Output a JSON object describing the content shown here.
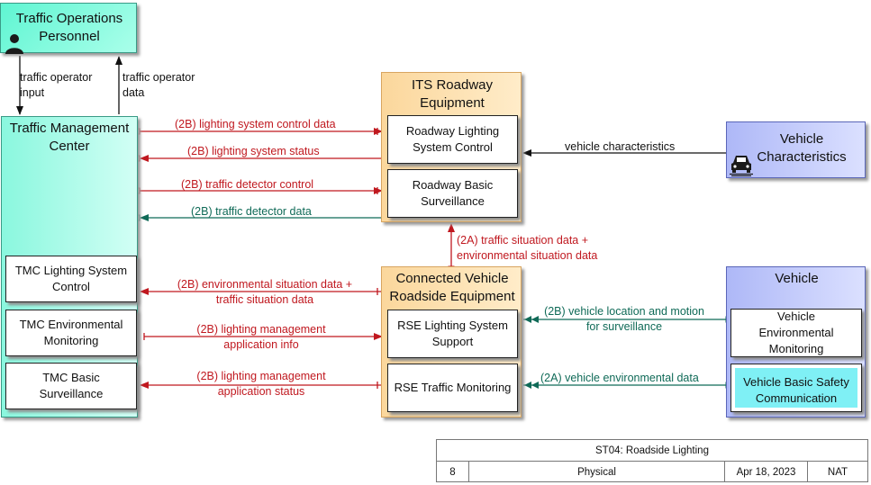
{
  "nodes": {
    "top": "Traffic Operations Personnel",
    "tmc": "Traffic Management Center",
    "its": "ITS Roadway Equipment",
    "cv": "Connected Vehicle Roadside Equipment",
    "vchar": "Vehicle Characteristics",
    "veh": "Vehicle"
  },
  "subs": {
    "tmc_light": "TMC Lighting System Control",
    "tmc_env": "TMC Environmental Monitoring",
    "tmc_basic": "TMC Basic Surveillance",
    "rls": "Roadway Lighting System Control",
    "rbs": "Roadway Basic Surveillance",
    "rse_light": "RSE Lighting System Support",
    "rse_traffic": "RSE Traffic Monitoring",
    "veh_env": "Vehicle Environmental Monitoring",
    "veh_bsc": "Vehicle Basic Safety Communication"
  },
  "flows": {
    "op_in": [
      "traffic operator",
      "input"
    ],
    "op_data": [
      "traffic operator",
      "data"
    ],
    "f1": "(2B) lighting system control data",
    "f2": "(2B) lighting system status",
    "f3": "(2B) traffic detector control",
    "f4": "(2B) traffic detector data",
    "vchar_flow": "vehicle characteristics",
    "sit": [
      "(2A) traffic situation data +",
      "environmental situation data"
    ],
    "env_sit": [
      "(2B) environmental situation data +",
      "traffic situation data"
    ],
    "lm_info": [
      "(2B) lighting management",
      "application info"
    ],
    "lm_status": [
      "(2B) lighting management",
      "application status"
    ],
    "vloc": [
      "(2B) vehicle location and motion",
      "for surveillance"
    ],
    "venv": "(2A) vehicle environmental data"
  },
  "titleblock": {
    "title": "ST04: Roadside Lighting",
    "num": "8",
    "view": "Physical",
    "date": "Apr 18, 2023",
    "scope": "NAT"
  },
  "colors": {
    "red": "#c0181f",
    "green": "#0f6a57",
    "black": "#111111"
  }
}
